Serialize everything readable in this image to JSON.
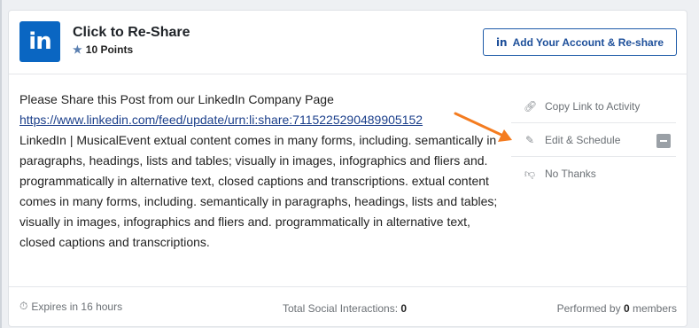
{
  "header": {
    "logo_text": "in",
    "title": "Click to Re-Share",
    "points": "10 Points",
    "reshare_icon": "in",
    "reshare_label": "Add Your Account & Re-share"
  },
  "post": {
    "line1": "Please Share this Post from our LinkedIn Company Page",
    "link": "https://www.linkedin.com/feed/update/urn:li:share:7115225290489905152",
    "body": "LinkedIn | MusicalEvent extual content comes in many forms, including. semantically in paragraphs, headings, lists and tables; visually in images, infographics and fliers and. programmatically in alternative text, closed captions and transcriptions. extual content comes in many forms, including. semantically in paragraphs, headings, lists and tables; visually in images, infographics and fliers and. programmatically in alternative text, closed captions and transcriptions."
  },
  "actions": [
    {
      "label": "Copy Link to Activity",
      "icon": "link-icon"
    },
    {
      "label": "Edit & Schedule",
      "icon": "pencil-icon"
    },
    {
      "label": "No Thanks",
      "icon": "thumbs-down-icon"
    }
  ],
  "footer": {
    "expires": "Expires in 16 hours",
    "interactions_label": "Total Social Interactions:",
    "interactions_value": "0",
    "performed_prefix": "Performed by",
    "performed_value": "0",
    "performed_suffix": "members"
  },
  "colors": {
    "brand": "#0a66c2",
    "button_border": "#1d5aa8",
    "arrow": "#f47c20"
  }
}
